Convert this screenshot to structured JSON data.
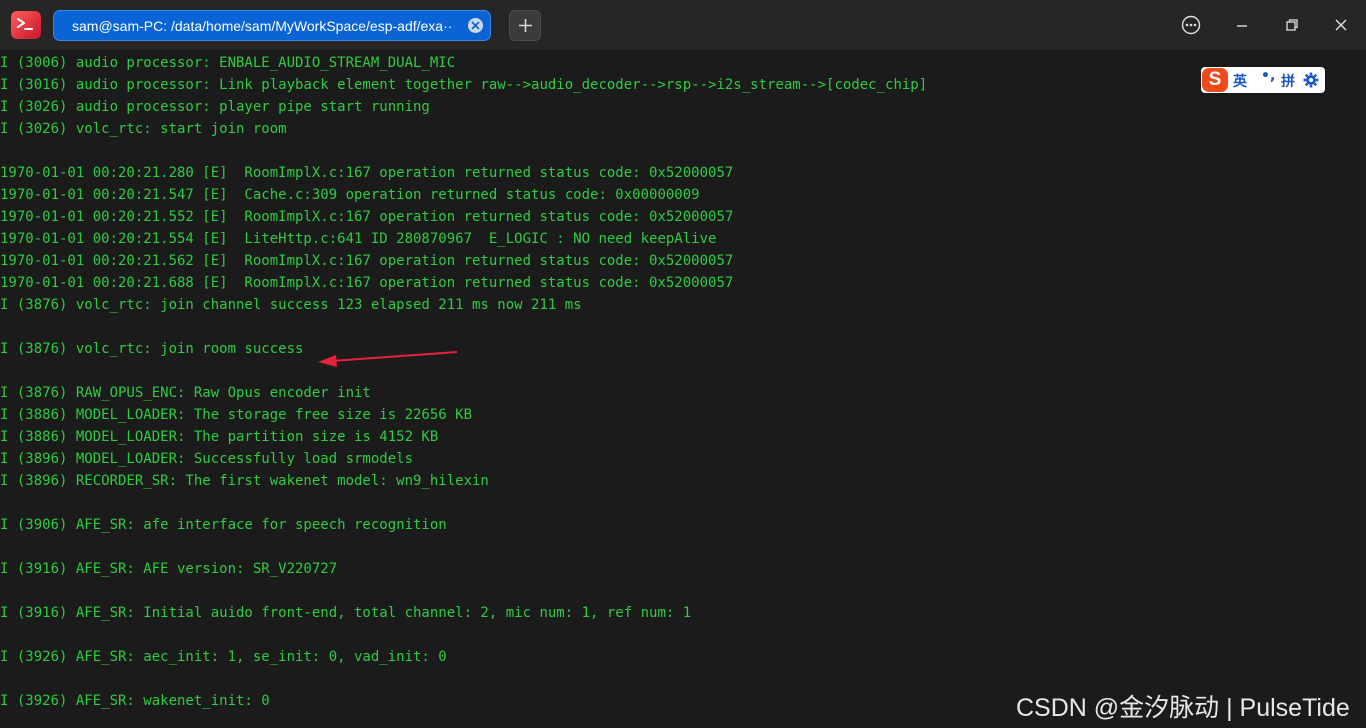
{
  "titlebar": {
    "tab_title": "sam@sam-PC: /data/home/sam/MyWorkSpace/esp-adf/exa···"
  },
  "terminal": {
    "lines": [
      "I (3006) audio processor: ENBALE_AUDIO_STREAM_DUAL_MIC",
      "I (3016) audio processor: Link playback element together raw-->audio_decoder-->rsp-->i2s_stream-->[codec_chip]",
      "I (3026) audio processor: player pipe start running",
      "I (3026) volc_rtc: start join room",
      "",
      "1970-01-01 00:20:21.280 [E]  RoomImplX.c:167 operation returned status code: 0x52000057",
      "1970-01-01 00:20:21.547 [E]  Cache.c:309 operation returned status code: 0x00000009",
      "1970-01-01 00:20:21.552 [E]  RoomImplX.c:167 operation returned status code: 0x52000057",
      "1970-01-01 00:20:21.554 [E]  LiteHttp.c:641 ID 280870967  E_LOGIC : NO need keepAlive",
      "1970-01-01 00:20:21.562 [E]  RoomImplX.c:167 operation returned status code: 0x52000057",
      "1970-01-01 00:20:21.688 [E]  RoomImplX.c:167 operation returned status code: 0x52000057",
      "I (3876) volc_rtc: join channel success 123 elapsed 211 ms now 211 ms",
      "",
      "I (3876) volc_rtc: join room success",
      "",
      "I (3876) RAW_OPUS_ENC: Raw Opus encoder init",
      "I (3886) MODEL_LOADER: The storage free size is 22656 KB",
      "I (3886) MODEL_LOADER: The partition size is 4152 KB",
      "I (3896) MODEL_LOADER: Successfully load srmodels",
      "I (3896) RECORDER_SR: The first wakenet model: wn9_hilexin",
      "",
      "I (3906) AFE_SR: afe interface for speech recognition",
      "",
      "I (3916) AFE_SR: AFE version: SR_V220727",
      "",
      "I (3916) AFE_SR: Initial auido front-end, total channel: 2, mic num: 1, ref num: 1",
      "",
      "I (3926) AFE_SR: aec_init: 1, se_init: 0, vad_init: 0",
      "",
      "I (3926) AFE_SR: wakenet_init: 0"
    ]
  },
  "ime": {
    "logo": "S",
    "mode": "英",
    "punct": "•,",
    "pinyin": "拼"
  },
  "watermark": "CSDN @金汐脉动 | PulseTide",
  "colors": {
    "terminal_text": "#2ecc40",
    "tab_active": "#0a64d6",
    "annotation_arrow": "#e8213a"
  }
}
